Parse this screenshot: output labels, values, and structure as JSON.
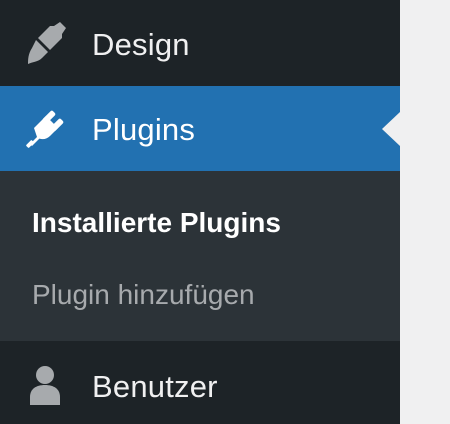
{
  "menu": {
    "design": {
      "label": "Design",
      "icon": "paintbrush-icon"
    },
    "plugins": {
      "label": "Plugins",
      "icon": "plugin-plug-icon",
      "current": true
    },
    "plugins_submenu": [
      {
        "label": "Installierte Plugins",
        "current": true
      },
      {
        "label": "Plugin hinzufügen",
        "current": false
      }
    ],
    "users": {
      "label": "Benutzer",
      "icon": "user-icon"
    }
  },
  "colors": {
    "sidebar_bg": "#1d2327",
    "submenu_bg": "#2c3338",
    "active_bg": "#2271b1",
    "icon_inactive": "#a7aaad",
    "text": "#f0f0f1",
    "page_bg": "#f0f0f1"
  }
}
